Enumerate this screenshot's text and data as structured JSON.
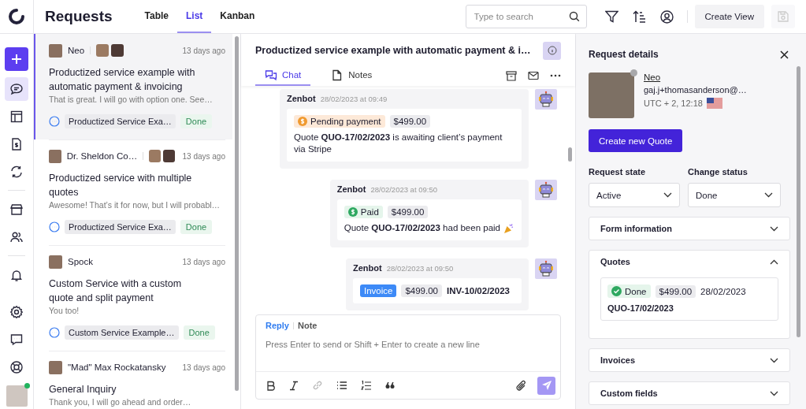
{
  "app": {
    "title": "Requests"
  },
  "view_tabs": [
    {
      "label": "Table",
      "selected": false
    },
    {
      "label": "List",
      "selected": true
    },
    {
      "label": "Kanban",
      "selected": false
    }
  ],
  "search": {
    "placeholder": "Type to search"
  },
  "create_view": "Create View",
  "save_disabled": true,
  "nav_groups": [
    [
      {
        "kind": "add",
        "selected": false
      },
      {
        "kind": "chat",
        "selected": true
      },
      {
        "kind": "layout",
        "selected": false
      },
      {
        "kind": "invoice",
        "selected": false
      },
      {
        "kind": "sync",
        "selected": false
      }
    ],
    [
      {
        "kind": "store",
        "selected": false
      },
      {
        "kind": "users",
        "selected": false
      }
    ],
    [
      {
        "kind": "bell",
        "selected": false
      }
    ]
  ],
  "nav_bottom": [
    {
      "kind": "gear",
      "selected": false
    },
    {
      "kind": "feedback",
      "selected": false
    },
    {
      "kind": "help",
      "selected": false
    }
  ],
  "user": {
    "online": true
  },
  "requests": [
    {
      "name": "Neo",
      "has_assignees": true,
      "time": "13 days ago",
      "title": "Productized service example with automatic payment & invoicing",
      "preview": "That is great. I will go with option one. See…",
      "tag": "Productized Service Exa…",
      "status": "Done",
      "selected": true
    },
    {
      "name": "Dr. Sheldon Co…",
      "has_assignees": true,
      "time": "13 days ago",
      "title": "Productized service with multiple quotes",
      "preview": "Awesome! That’s it for now, but I will probabl…",
      "tag": "Productized Service Exa…",
      "status": "Done",
      "selected": false
    },
    {
      "name": "Spock",
      "has_assignees": false,
      "time": "13 days ago",
      "title": "Custom Service with a custom quote and split payment",
      "preview": "You too!",
      "tag": "Custom Service Example…",
      "status": "Done",
      "selected": false
    },
    {
      "name": "\"Mad\" Max Rockatansky",
      "has_assignees": false,
      "time": "13 days ago",
      "title": "General Inquiry",
      "preview": "Thank you, I will go ahead and order…",
      "selected": false
    }
  ],
  "conversation": {
    "title": "Productized service example with automatic payment & i…",
    "tabs": [
      {
        "label": "Chat",
        "kind": "chat",
        "selected": true
      },
      {
        "label": "Notes",
        "kind": "notes",
        "selected": false
      }
    ],
    "messages": [
      {
        "author": "Zenbot",
        "time": "28/02/2023 at 09:49",
        "kind": "pending",
        "badge": "Pending payment",
        "amount": "$499.00",
        "text": "Quote **QUO-17/02/2023** is awaiting client’s payment via Stripe"
      },
      {
        "author": "Zenbot",
        "time": "28/02/2023 at 09:50",
        "kind": "paid",
        "badge": "Paid",
        "amount": "$499.00",
        "text": "Quote **QUO-17/02/2023** had been paid",
        "celebrate": true
      },
      {
        "author": "Zenbot",
        "time": "28/02/2023 at 09:50",
        "kind": "invoice",
        "badge": "Invoice",
        "amount": "$499.00",
        "reference": "INV-10/02/2023"
      }
    ],
    "composer": {
      "modes": [
        {
          "label": "Reply",
          "selected": true
        },
        {
          "label": "Note",
          "selected": false
        }
      ],
      "placeholder": "Press Enter to send or Shift + Enter to create a new line"
    }
  },
  "details": {
    "title": "Request details",
    "contact": {
      "name": "Neo",
      "email": "gaj.j+thomasanderson@…",
      "local_time": "UTC + 2, 12:18",
      "online": false
    },
    "create_quote": "Create new Quote",
    "fields": [
      {
        "label": "Request state",
        "value": "Active"
      },
      {
        "label": "Change status",
        "value": "Done"
      }
    ],
    "sections": [
      {
        "title": "Form information",
        "expanded": false
      },
      {
        "title": "Quotes",
        "expanded": true,
        "quotes": [
          {
            "status": "Done",
            "amount": "$499.00",
            "date": "28/02/2023",
            "number": "QUO-17/02/2023"
          }
        ]
      },
      {
        "title": "Invoices",
        "expanded": false
      },
      {
        "title": "Custom fields",
        "expanded": false
      }
    ]
  }
}
